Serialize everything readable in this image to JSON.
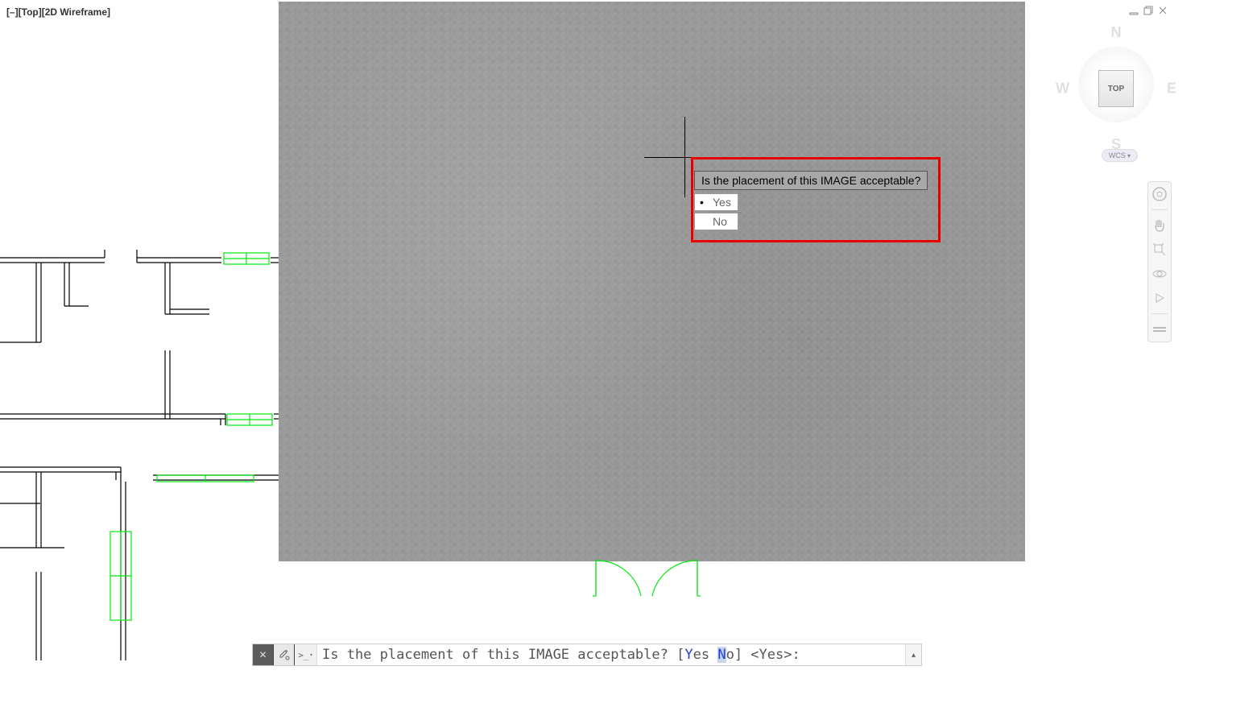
{
  "view_label": "[–][Top][2D Wireframe]",
  "viewcube": {
    "n": "N",
    "s": "S",
    "e": "E",
    "w": "W",
    "top": "TOP"
  },
  "wcs": "WCS",
  "prompt": {
    "title": "Is the placement of this IMAGE acceptable?",
    "yes": "Yes",
    "no": "No"
  },
  "cmd": {
    "prefix": "Is the placement of this IMAGE acceptable? [",
    "yes_key": "Y",
    "yes_rest": "es ",
    "no_key": "N",
    "no_rest": "o",
    "suffix": "] <Yes>:"
  }
}
